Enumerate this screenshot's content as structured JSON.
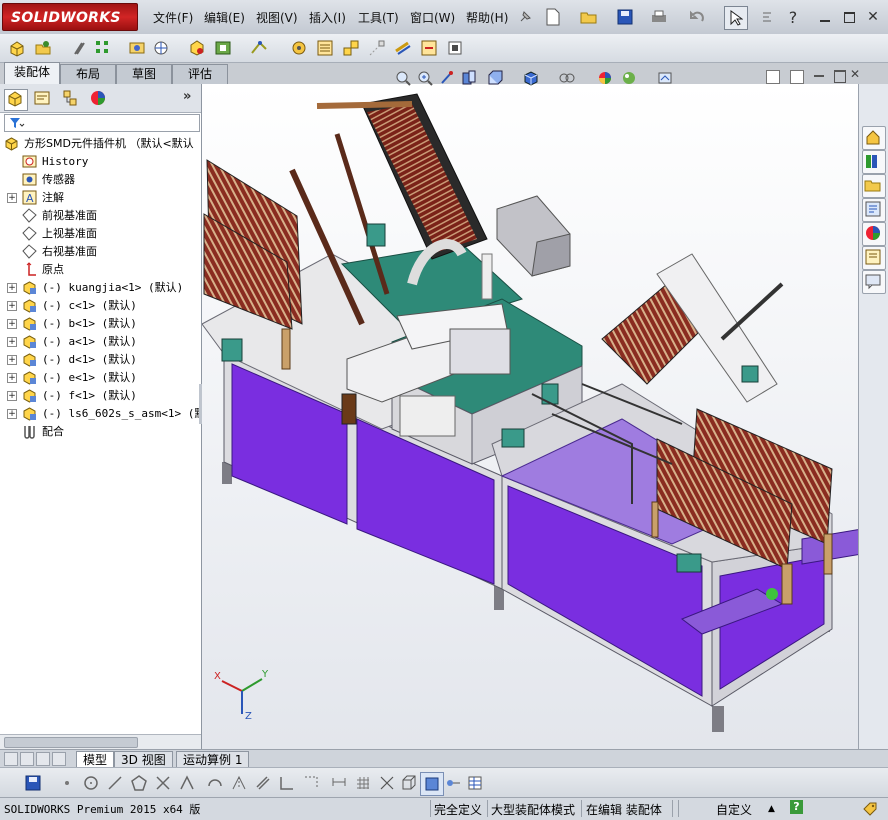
{
  "app": {
    "logo": "SOLIDWORKS"
  },
  "menu": [
    "文件(F)",
    "编辑(E)",
    "视图(V)",
    "插入(I)",
    "工具(T)",
    "窗口(W)",
    "帮助(H)"
  ],
  "tabs": [
    {
      "label": "装配体",
      "active": true
    },
    {
      "label": "布局",
      "active": false
    },
    {
      "label": "草图",
      "active": false
    },
    {
      "label": "评估",
      "active": false
    }
  ],
  "tree": {
    "root": "方形SMD元件插件机 （默认<默认",
    "items": [
      {
        "label": "History",
        "expand": false,
        "icon": "history-icon"
      },
      {
        "label": "传感器",
        "expand": false,
        "icon": "sensor-icon"
      },
      {
        "label": "注解",
        "expand": true,
        "icon": "annotation-icon"
      },
      {
        "label": "前视基准面",
        "expand": false,
        "icon": "plane-icon"
      },
      {
        "label": "上视基准面",
        "expand": false,
        "icon": "plane-icon"
      },
      {
        "label": "右视基准面",
        "expand": false,
        "icon": "plane-icon"
      },
      {
        "label": "原点",
        "expand": false,
        "icon": "origin-icon"
      },
      {
        "label": "(-) kuangjia<1> (默认)",
        "expand": true,
        "icon": "subassembly-icon"
      },
      {
        "label": "(-) c<1> (默认)",
        "expand": true,
        "icon": "subassembly-icon"
      },
      {
        "label": "(-) b<1> (默认)",
        "expand": true,
        "icon": "subassembly-icon"
      },
      {
        "label": "(-) a<1> (默认)",
        "expand": true,
        "icon": "subassembly-icon"
      },
      {
        "label": "(-) d<1> (默认)",
        "expand": true,
        "icon": "subassembly-icon"
      },
      {
        "label": "(-) e<1> (默认)",
        "expand": true,
        "icon": "subassembly-icon"
      },
      {
        "label": "(-) f<1> (默认)",
        "expand": true,
        "icon": "subassembly-icon"
      },
      {
        "label": "(-) ls6_602s_s_asm<1> (默认",
        "expand": true,
        "icon": "subassembly-icon"
      },
      {
        "label": "配合",
        "expand": false,
        "icon": "mates-icon"
      }
    ]
  },
  "triad": {
    "x": "X",
    "y": "Y",
    "z": "Z"
  },
  "bottom_tabs": [
    {
      "label": "模型",
      "active": true
    },
    {
      "label": "3D 视图",
      "active": false
    },
    {
      "label": "运动算例 1",
      "active": false
    }
  ],
  "status": {
    "product": "SOLIDWORKS Premium 2015 x64 版",
    "definition": "完全定义",
    "mode": "大型装配体模式",
    "editing": "在编辑 装配体",
    "units": "自定义",
    "units_arrow": "▲",
    "help": "?"
  },
  "colors": {
    "purple_panel": "#7a2ee0",
    "frame": "#d8d8dc",
    "teal": "#2e8a78",
    "tray": "#7a2018",
    "brand": "#c81e1e"
  }
}
